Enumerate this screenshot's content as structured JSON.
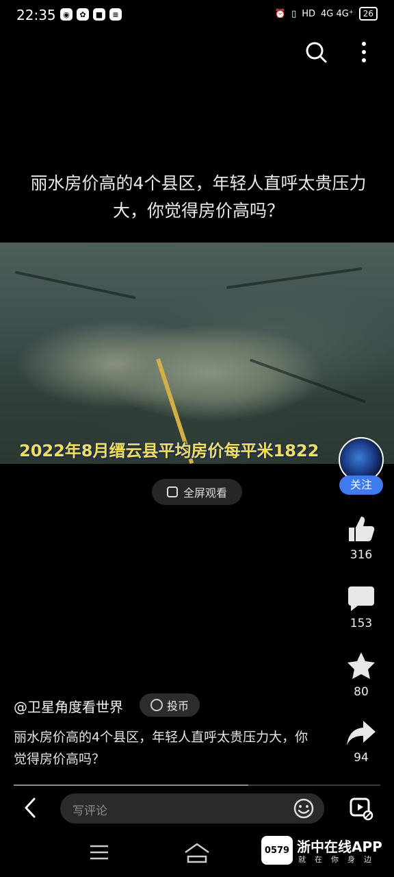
{
  "status_bar": {
    "time": "22:35",
    "network": "4G 4G⁺",
    "battery": "26",
    "hd": "HD"
  },
  "header": {
    "title": "丽水房价高的4个县区，年轻人直呼太贵压力大，你觉得房价高吗？"
  },
  "video": {
    "subtitle": "2022年8月缙云县平均房价每平米1822",
    "fullscreen_label": "全屏观看"
  },
  "sidebar": {
    "follow_label": "关注",
    "likes": "316",
    "comments": "153",
    "favorites": "80",
    "shares": "94"
  },
  "post": {
    "author": "@卫星角度看世界",
    "coin_label": "投币",
    "description": "丽水房价高的4个县区，年轻人直呼太贵压力大，你觉得房价高吗？",
    "progress": 0.64
  },
  "bottom_bar": {
    "comment_placeholder": "写评论"
  },
  "watermark": {
    "logo_text": "0579",
    "title": "浙中在线APP",
    "slogan": "就在你身边"
  },
  "colors": {
    "accent": "#3f7bf0",
    "subtitle": "#f4e14a"
  }
}
